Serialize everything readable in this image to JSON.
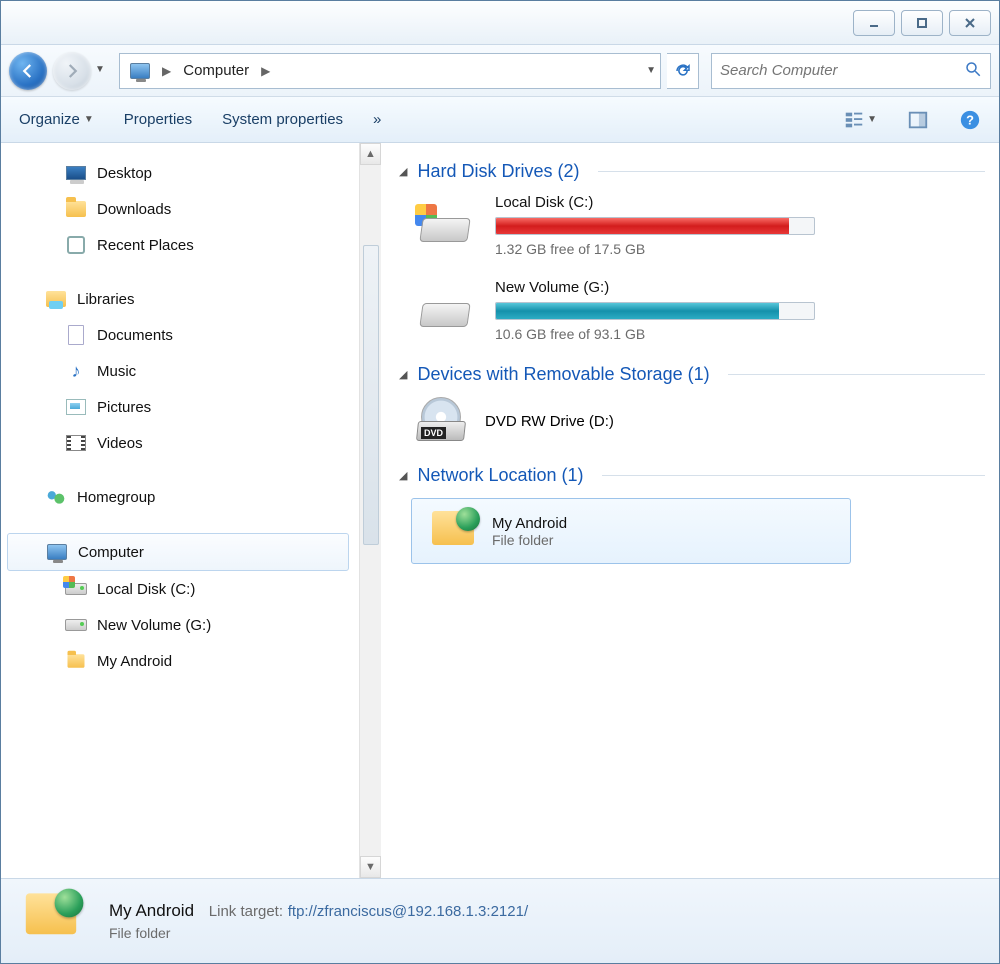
{
  "titlebar": {
    "minimize": "minimize",
    "maximize": "maximize",
    "close": "close"
  },
  "nav": {
    "back": "Back",
    "forward": "Forward",
    "dropdown": "Recent locations"
  },
  "breadcrumb": {
    "root_icon": "computer-icon",
    "location": "Computer"
  },
  "address": {
    "dropdown": "▼",
    "refresh": "Refresh"
  },
  "search": {
    "placeholder": "Search Computer"
  },
  "toolbar": {
    "organize": "Organize",
    "properties": "Properties",
    "system_properties": "System properties",
    "overflow": "»",
    "view": "Change view",
    "preview": "Preview pane",
    "help": "Help"
  },
  "sidebar": {
    "favorites": [
      {
        "icon": "desktop-icon",
        "label": "Desktop"
      },
      {
        "icon": "folder-icon",
        "label": "Downloads"
      },
      {
        "icon": "recent-icon",
        "label": "Recent Places"
      }
    ],
    "libraries_label": "Libraries",
    "libraries": [
      {
        "icon": "document-icon",
        "label": "Documents"
      },
      {
        "icon": "music-icon",
        "label": "Music"
      },
      {
        "icon": "pictures-icon",
        "label": "Pictures"
      },
      {
        "icon": "videos-icon",
        "label": "Videos"
      }
    ],
    "homegroup_label": "Homegroup",
    "computer_label": "Computer",
    "computer": [
      {
        "icon": "drive-win-icon",
        "label": "Local Disk (C:)"
      },
      {
        "icon": "drive-icon",
        "label": "New Volume (G:)"
      },
      {
        "icon": "netfolder-icon",
        "label": "My Android"
      }
    ]
  },
  "main": {
    "hdd_header": "Hard Disk Drives (2)",
    "drives": [
      {
        "name": "Local Disk (C:)",
        "stats": "1.32 GB free of 17.5 GB",
        "fill_class": "red",
        "has_winlogo": true
      },
      {
        "name": "New Volume (G:)",
        "stats": "10.6 GB free of 93.1 GB",
        "fill_class": "teal",
        "has_winlogo": false
      }
    ],
    "removable_header": "Devices with Removable Storage (1)",
    "dvd_label": "DVD RW Drive (D:)",
    "dvd_badge": "DVD",
    "network_header": "Network Location (1)",
    "network_item": {
      "name": "My Android",
      "sub": "File folder"
    }
  },
  "statusbar": {
    "name": "My Android",
    "key": "Link target:",
    "val": "ftp://zfranciscus@192.168.1.3:2121/",
    "sub": "File folder"
  }
}
